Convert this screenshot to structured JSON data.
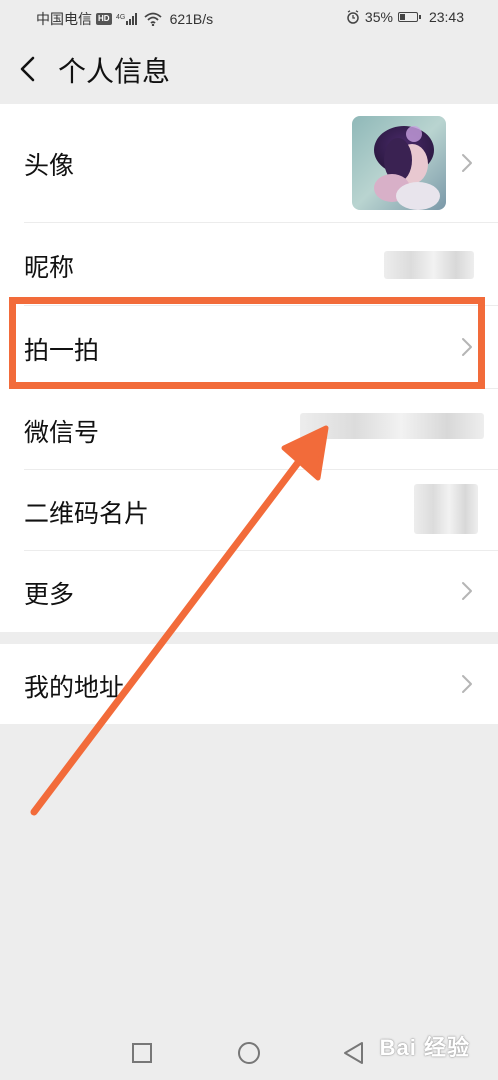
{
  "status_bar": {
    "carrier": "中国电信",
    "hd_badge": "HD",
    "network_type": "4G",
    "speed": "621B/s",
    "battery": "35%",
    "battery_level": 0.35,
    "time": "23:43"
  },
  "header": {
    "title": "个人信息"
  },
  "profile_rows": [
    {
      "label": "头像",
      "has_chevron": true
    },
    {
      "label": "昵称",
      "has_chevron": false
    },
    {
      "label": "拍一拍",
      "has_chevron": true,
      "highlighted": true
    },
    {
      "label": "微信号",
      "has_chevron": false
    },
    {
      "label": "二维码名片",
      "has_chevron": false
    },
    {
      "label": "更多",
      "has_chevron": true
    }
  ],
  "address_rows": [
    {
      "label": "我的地址",
      "has_chevron": true
    }
  ],
  "annotation": {
    "color": "#f26b3a"
  },
  "watermark": {
    "text": "Bai 经验"
  },
  "icons": {
    "back": "chevron-left-icon",
    "row_arrow": "chevron-right-icon",
    "recents": "square-icon",
    "home": "circle-icon",
    "back_nav": "triangle-left-icon"
  }
}
